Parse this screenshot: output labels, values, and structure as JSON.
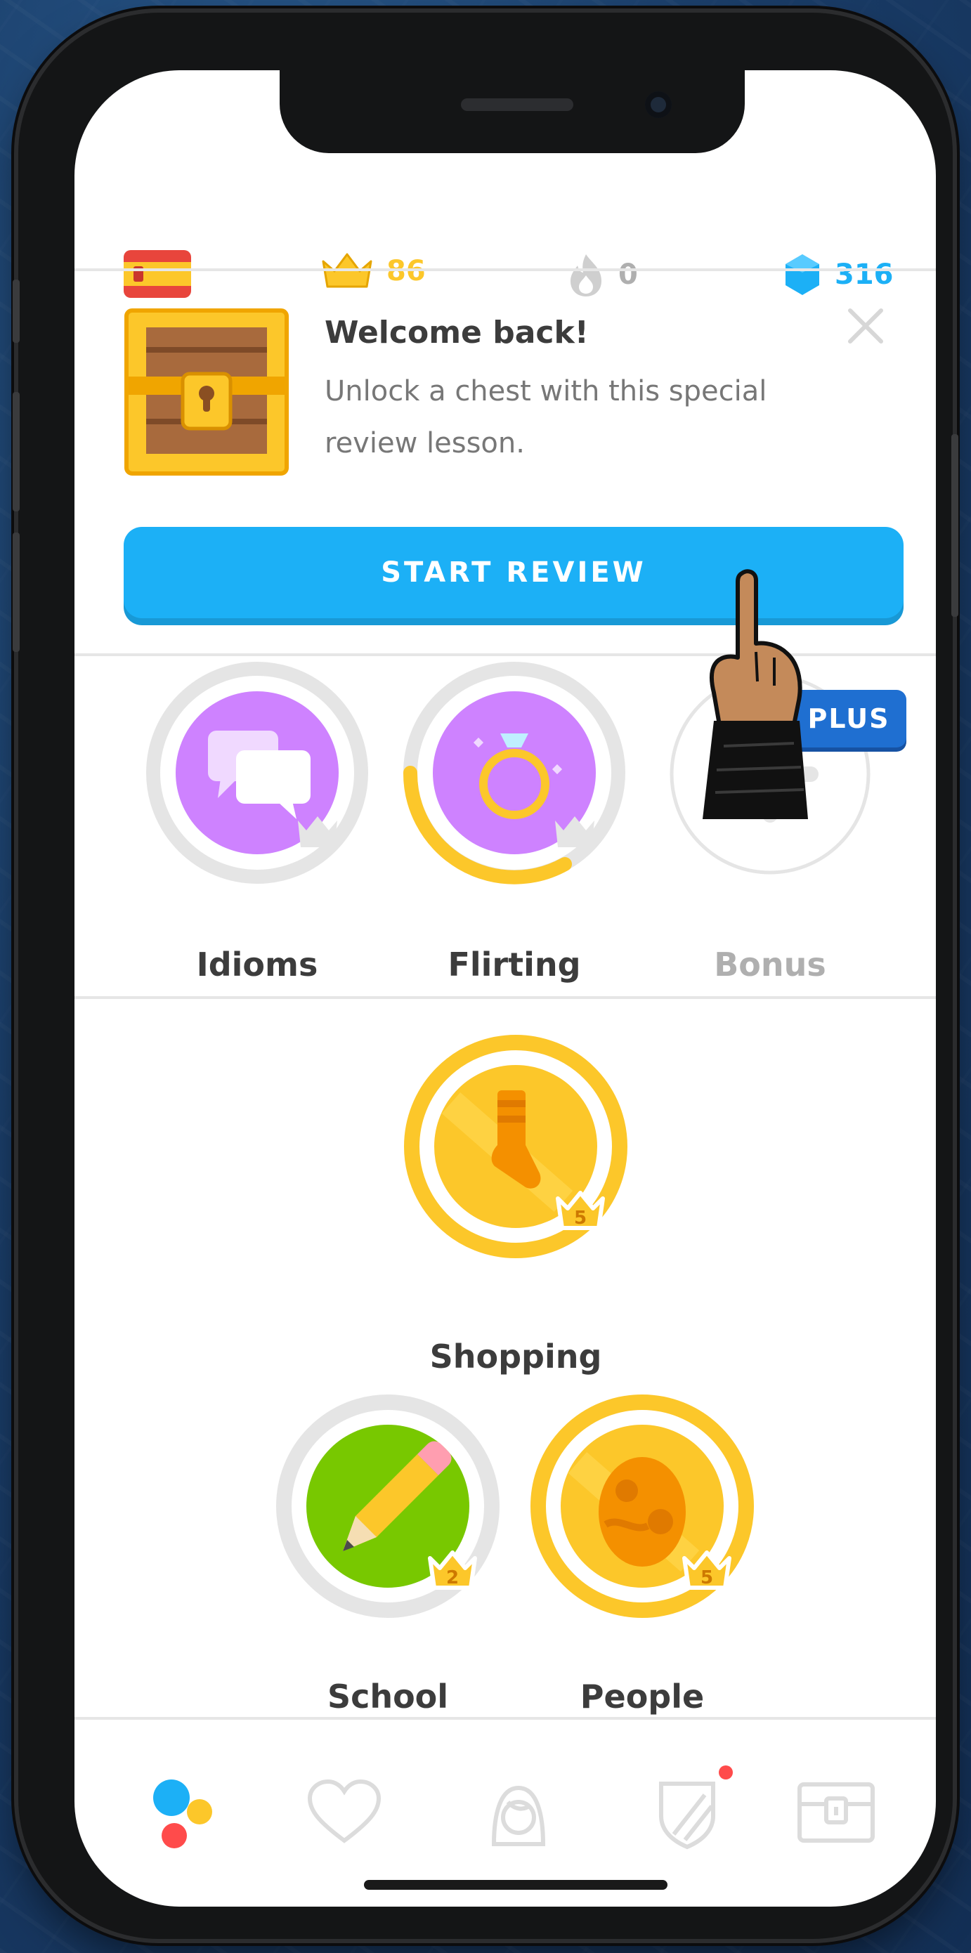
{
  "header": {
    "language_flag": "spain-flag",
    "crowns": "86",
    "streak": "0",
    "gems": "316",
    "colors": {
      "crown": "#fcc72a",
      "streak_inactive": "#afafaf",
      "gems": "#1cb0f6"
    }
  },
  "welcome_card": {
    "title": "Welcome back!",
    "body": "Unlock a chest with this special review lesson.",
    "button_label": "START REVIEW",
    "icons": [
      "treasure-chest-icon",
      "close-icon"
    ]
  },
  "skills_row_1": [
    {
      "label": "Idioms",
      "icon": "speech-bubbles-icon",
      "color": "#ce82ff"
    },
    {
      "label": "Flirting",
      "icon": "ring-icon",
      "color": "#ce82ff",
      "progress": 0.45
    },
    {
      "label": "Bonus",
      "icon": "plus-icon",
      "locked": true,
      "badge": "PLUS"
    }
  ],
  "skills_row_2": [
    {
      "label": "Shopping",
      "icon": "sock-icon",
      "crown_level": "5",
      "color": "#fcc72a"
    }
  ],
  "skills_row_3": [
    {
      "label": "School",
      "icon": "pencil-icon",
      "crown_level": "2",
      "color": "#78c800"
    },
    {
      "label": "People",
      "icon": "egg-icon",
      "crown_level": "5",
      "color": "#fcc72a"
    }
  ],
  "navbar": {
    "items": [
      "learn-icon",
      "heart-icon",
      "profile-icon",
      "league-shield-icon",
      "shop-chest-icon"
    ],
    "notification_color": "#ff4b4b"
  }
}
